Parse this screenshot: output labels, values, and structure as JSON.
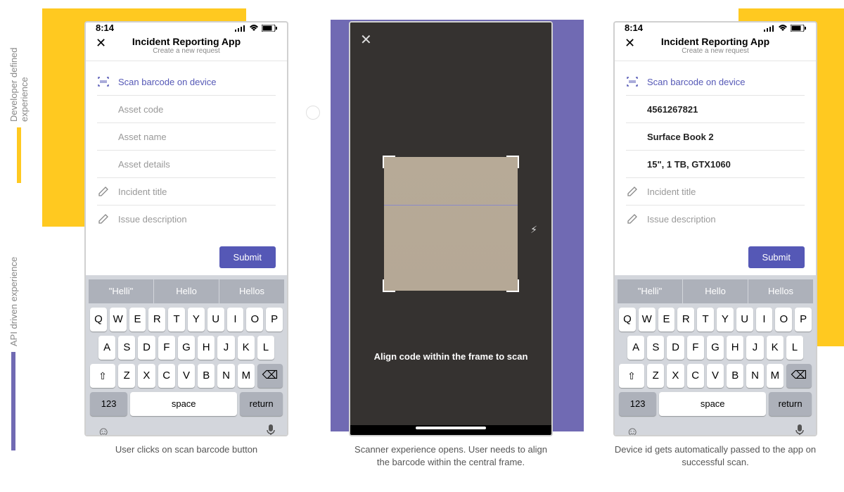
{
  "labels": {
    "developer": "Developer defined experience",
    "api": "API driven experience"
  },
  "phone": {
    "time": "8:14",
    "app_title": "Incident Reporting App",
    "app_subtitle": "Create a new request",
    "scan_link": "Scan barcode on device",
    "fields": {
      "asset_code_ph": "Asset code",
      "asset_name_ph": "Asset name",
      "asset_details_ph": "Asset details",
      "incident_title_ph": "Incident title",
      "issue_desc_ph": "Issue description",
      "asset_code_val": "4561267821",
      "asset_name_val": "Surface Book 2",
      "asset_details_val": "15\", 1 TB, GTX1060"
    },
    "submit": "Submit",
    "keyboard": {
      "sugg1": "\"Helli\"",
      "sugg2": "Hello",
      "sugg3": "Hellos",
      "row1": [
        "Q",
        "W",
        "E",
        "R",
        "T",
        "Y",
        "U",
        "I",
        "O",
        "P"
      ],
      "row2": [
        "A",
        "S",
        "D",
        "F",
        "G",
        "H",
        "J",
        "K",
        "L"
      ],
      "row3": [
        "Z",
        "X",
        "C",
        "V",
        "B",
        "N",
        "M"
      ],
      "fn": "123",
      "space": "space",
      "ret": "return"
    }
  },
  "scanner": {
    "caption": "Align code within the frame to scan"
  },
  "captions": {
    "c1": "User clicks on scan barcode button",
    "c2": "Scanner experience opens. User needs to align the barcode within the central frame.",
    "c3": "Device id gets automatically passed to the app on successful scan."
  }
}
